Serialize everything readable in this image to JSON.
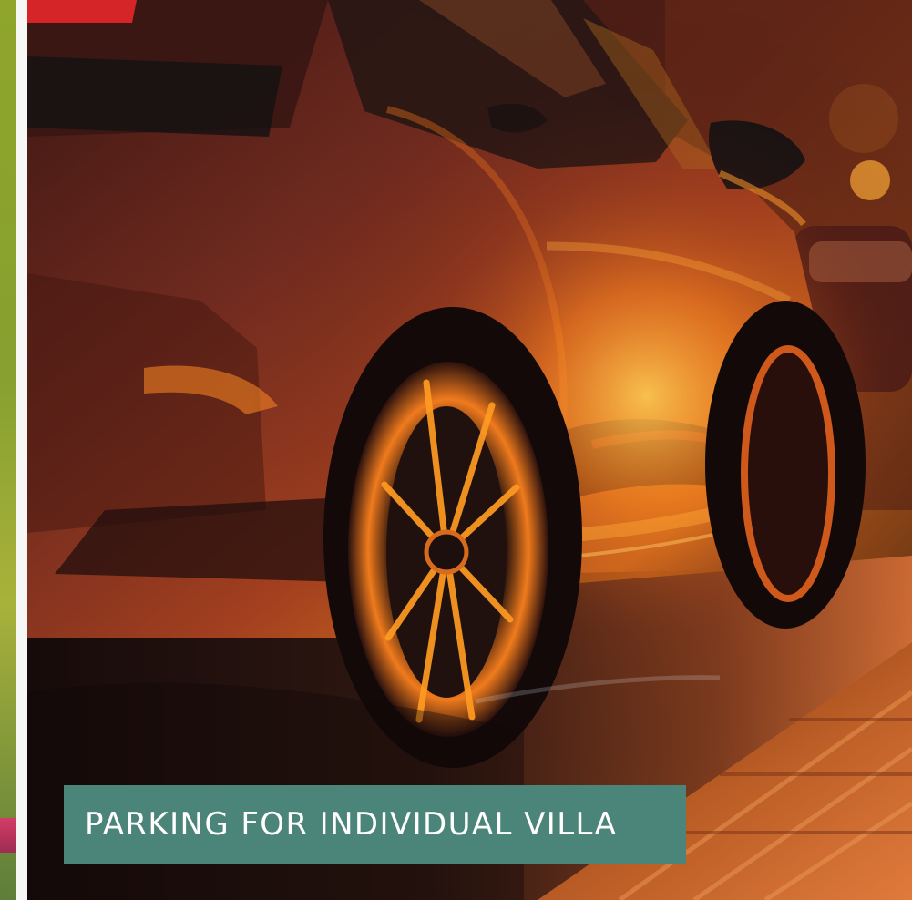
{
  "image": {
    "description_type": "photo-card",
    "caption": "PARKING FOR INDIVIDUAL VILLA",
    "colors": {
      "caption_background": "#4b8478",
      "caption_text": "#ffffff",
      "car_body": "#7b2f1e",
      "accent_glow": "#ff9a1f",
      "left_strip_green": "#8fa52b",
      "left_strip_pink": "#d43c67"
    },
    "icons": []
  }
}
